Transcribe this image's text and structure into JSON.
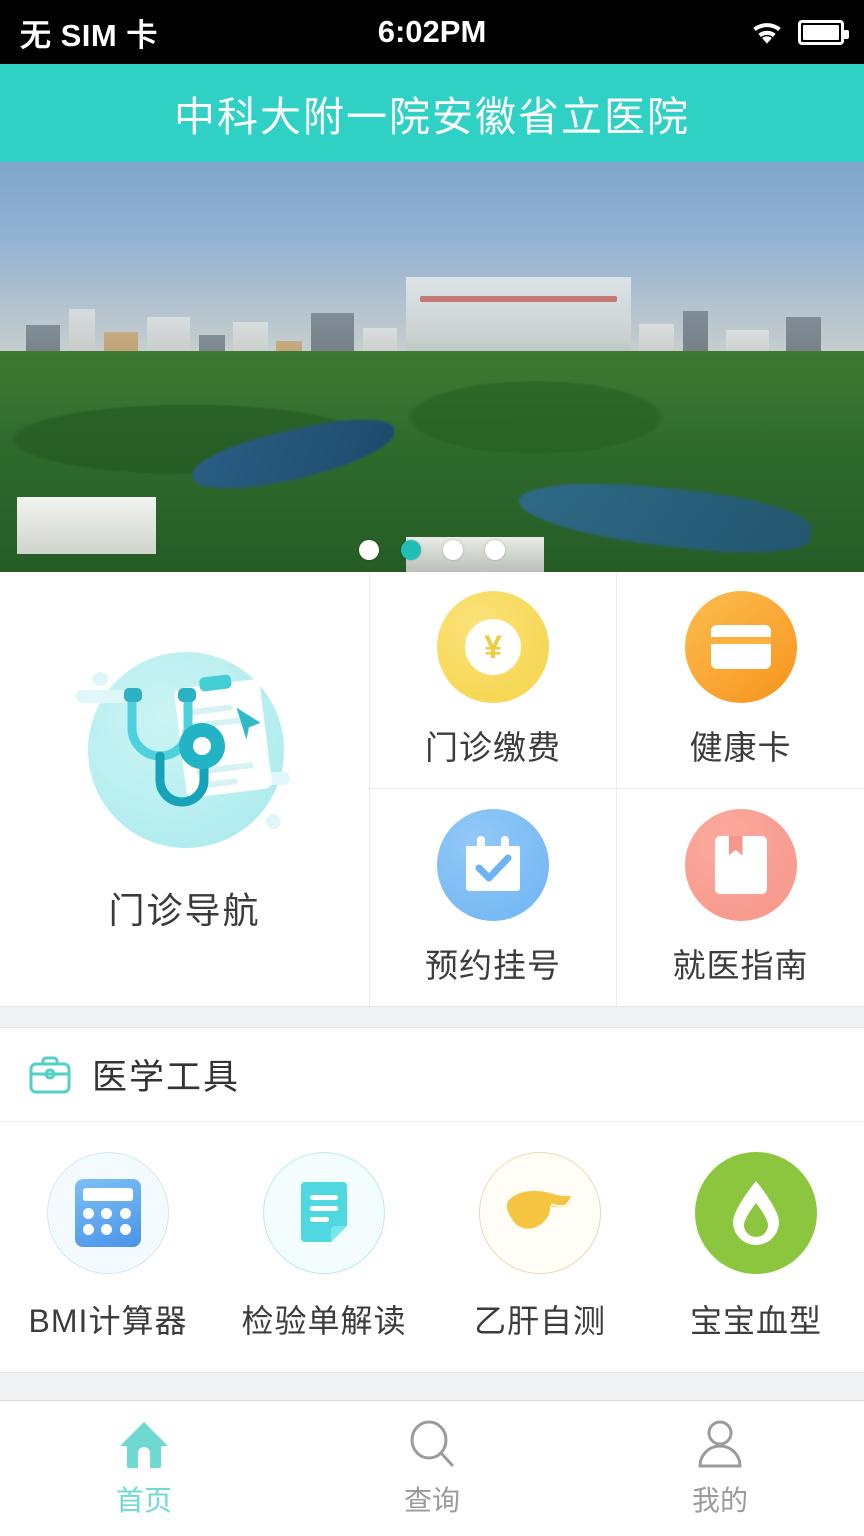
{
  "status_bar": {
    "carrier": "无 SIM 卡",
    "time": "6:02PM",
    "wifi_icon": "wifi-icon",
    "battery_icon": "battery-full-icon"
  },
  "header": {
    "title": "中科大附一院安徽省立医院",
    "background_color": "#2ed1c3"
  },
  "banner": {
    "icon": "hospital-aerial-photo",
    "dot_count": 4,
    "active_dot_index": 1,
    "active_dot_color": "#1fbfb8",
    "inactive_dot_color": "#ffffff"
  },
  "quick_actions": {
    "feature": {
      "label": "门诊导航",
      "icon": "stethoscope-clipboard-icon",
      "color": "#a8e9ec"
    },
    "items": [
      {
        "label": "门诊缴费",
        "icon": "yen-coin-icon",
        "color": "#f5d449"
      },
      {
        "label": "健康卡",
        "icon": "credit-card-icon",
        "color": "#f7941e"
      },
      {
        "label": "预约挂号",
        "icon": "calendar-check-icon",
        "color": "#6db4f2"
      },
      {
        "label": "就医指南",
        "icon": "book-guide-icon",
        "color": "#f7968a"
      }
    ]
  },
  "tools_section": {
    "title": "医学工具",
    "icon": "medical-kit-icon",
    "icon_color": "#4fd1c5",
    "items": [
      {
        "label": "BMI计算器",
        "icon": "calculator-icon",
        "color": "#4a94e8"
      },
      {
        "label": "检验单解读",
        "icon": "document-lines-icon",
        "color": "#4fd8e0"
      },
      {
        "label": "乙肝自测",
        "icon": "liver-icon",
        "color": "#f5c542"
      },
      {
        "label": "宝宝血型",
        "icon": "blood-drop-icon",
        "color": "#8cc63f"
      }
    ]
  },
  "tab_bar": {
    "active_color": "#6fd9d2",
    "inactive_color": "#9b9b9b",
    "tabs": [
      {
        "label": "首页",
        "icon": "home-icon",
        "active": true
      },
      {
        "label": "查询",
        "icon": "search-icon",
        "active": false
      },
      {
        "label": "我的",
        "icon": "person-icon",
        "active": false
      }
    ]
  }
}
